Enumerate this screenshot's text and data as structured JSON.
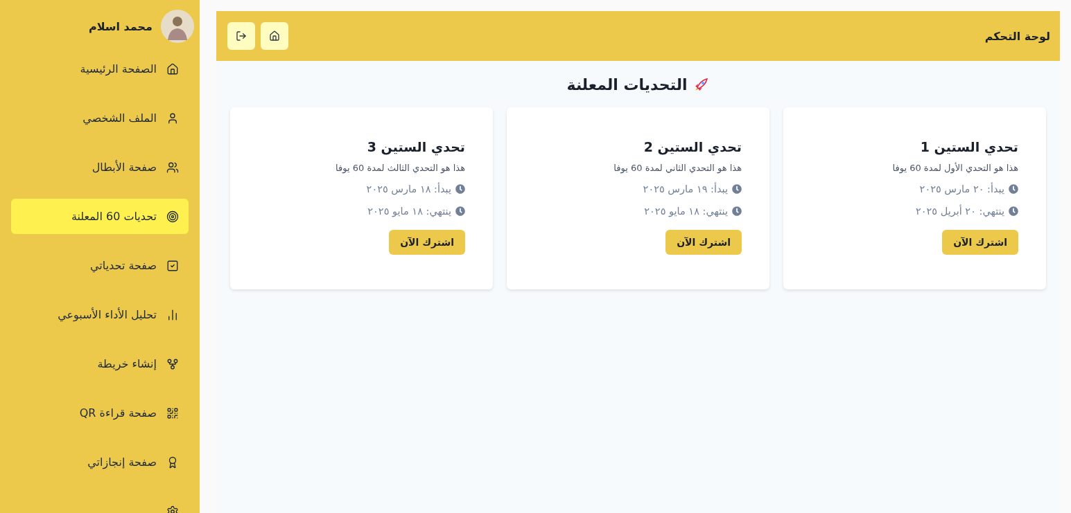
{
  "sidebar": {
    "user_name": "محمد اسلام",
    "items": [
      {
        "label": "الصفحة الرئيسية",
        "selected": false
      },
      {
        "label": "الملف الشخصي",
        "selected": false
      },
      {
        "label": "صفحة الأبطال",
        "selected": false
      },
      {
        "label": "تحديات 60 المعلنة",
        "selected": true
      },
      {
        "label": "صفحة تحدياتي",
        "selected": false
      },
      {
        "label": "تحليل الأداء الأسبوعي",
        "selected": false
      },
      {
        "label": "إنشاء خريطة",
        "selected": false
      },
      {
        "label": "صفحة قراءة QR",
        "selected": false
      },
      {
        "label": "صفحة إنجازاتي",
        "selected": false
      }
    ]
  },
  "header": {
    "title": "لوحة التحكم"
  },
  "heading": "التحديات المعلنة",
  "challenges": [
    {
      "title": "تحدي الستين 1",
      "description": "هذا هو التحدي الأول لمدة 60 يوفا",
      "start": "يبدأ: ٢٠ مارس ٢٠٢٥",
      "end": "ينتهي: ٢٠ أبريل ٢٠٢٥",
      "button": "اشترك الآن"
    },
    {
      "title": "تحدي الستين 2",
      "description": "هذا هو التحدي الثاني لمدة 60 يوفا",
      "start": "يبدأ: ١٩ مارس ٢٠٢٥",
      "end": "ينتهي: ١٨ مايو ٢٠٢٥",
      "button": "اشترك الآن"
    },
    {
      "title": "تحدي الستين 3",
      "description": "هذا هو التحدي الثالث لمدة 60 يوفا",
      "start": "يبدأ: ١٨ مارس ٢٠٢٥",
      "end": "ينتهي: ١٨ مايو ٢٠٢٥",
      "button": "اشترك الآن"
    }
  ]
}
